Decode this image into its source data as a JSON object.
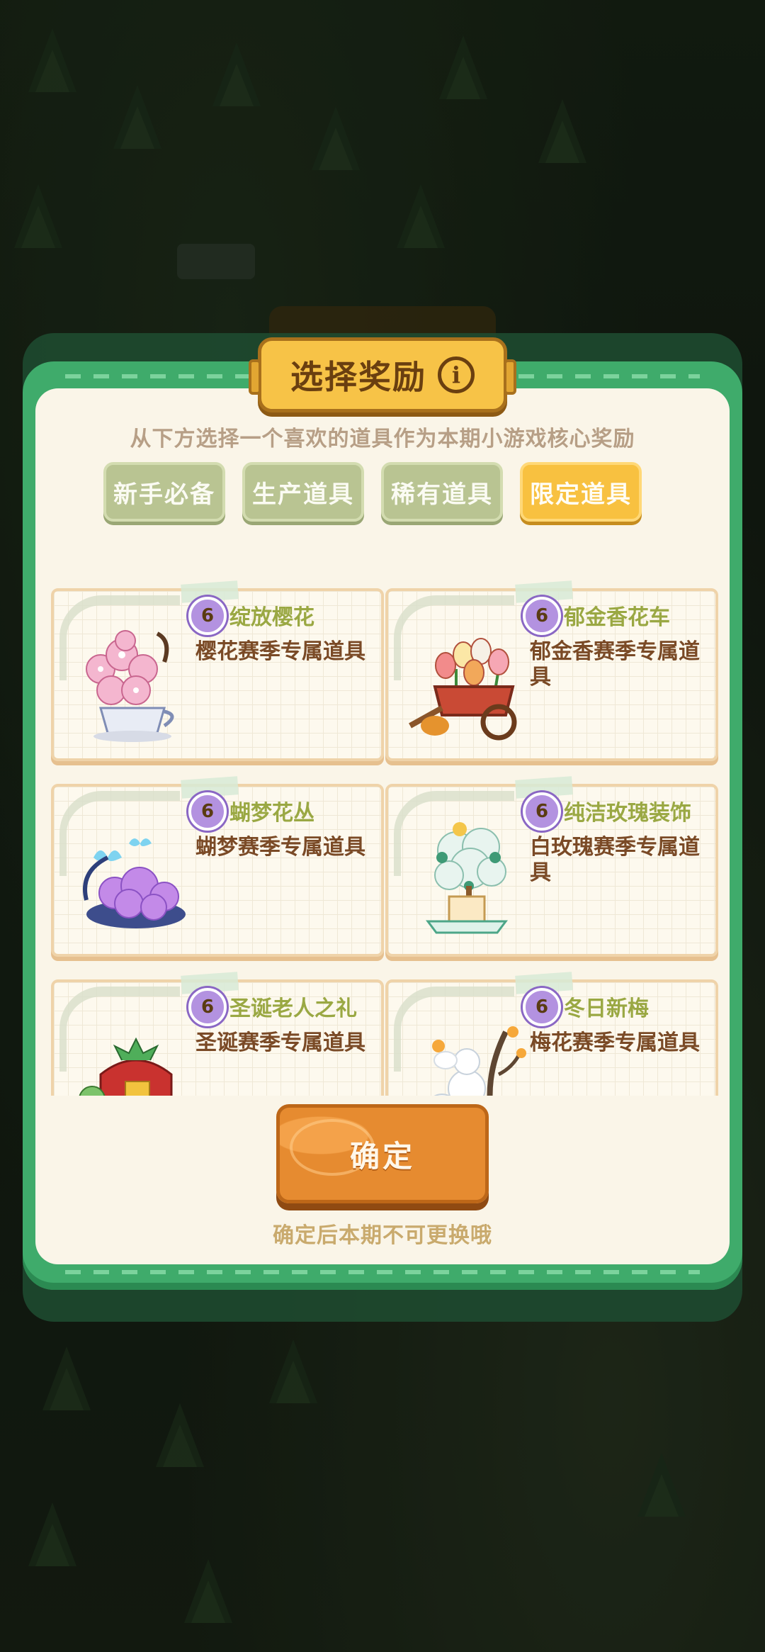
{
  "dialog": {
    "title": "选择奖励",
    "info_icon": "info-icon",
    "subtitle": "从下方选择一个喜欢的道具作为本期小游戏核心奖励",
    "tabs": [
      {
        "label": "新手必备",
        "active": false
      },
      {
        "label": "生产道具",
        "active": false
      },
      {
        "label": "稀有道具",
        "active": false
      },
      {
        "label": "限定道具",
        "active": true
      }
    ],
    "items": [
      {
        "level": "6",
        "name": "绽放樱花",
        "desc": "樱花赛季专属道具",
        "icon": "cherry-blossom-teacup-icon"
      },
      {
        "level": "6",
        "name": "郁金香花车",
        "desc": "郁金香赛季专属道具",
        "icon": "tulip-cart-icon"
      },
      {
        "level": "6",
        "name": "蝴梦花丛",
        "desc": "蝴梦赛季专属道具",
        "icon": "butterfly-flower-bush-icon"
      },
      {
        "level": "6",
        "name": "纯洁玫瑰装饰",
        "desc": "白玫瑰赛季专属道具",
        "icon": "white-rose-tree-icon"
      },
      {
        "level": "6",
        "name": "圣诞老人之礼",
        "desc": "圣诞赛季专属道具",
        "icon": "christmas-gift-sack-icon"
      },
      {
        "level": "6",
        "name": "冬日新梅",
        "desc": "梅花赛季专属道具",
        "icon": "winter-plum-snowman-icon"
      }
    ],
    "confirm_label": "确定",
    "notice": "确定后本期不可更换哦"
  },
  "colors": {
    "frame_green": "#3fab6b",
    "panel_cream": "#faf5e8",
    "tab_active": "#f8c140",
    "tab_inactive": "#b9c492",
    "confirm_orange": "#e68b30",
    "item_name": "#9aa843",
    "item_desc": "#7a4a26"
  }
}
